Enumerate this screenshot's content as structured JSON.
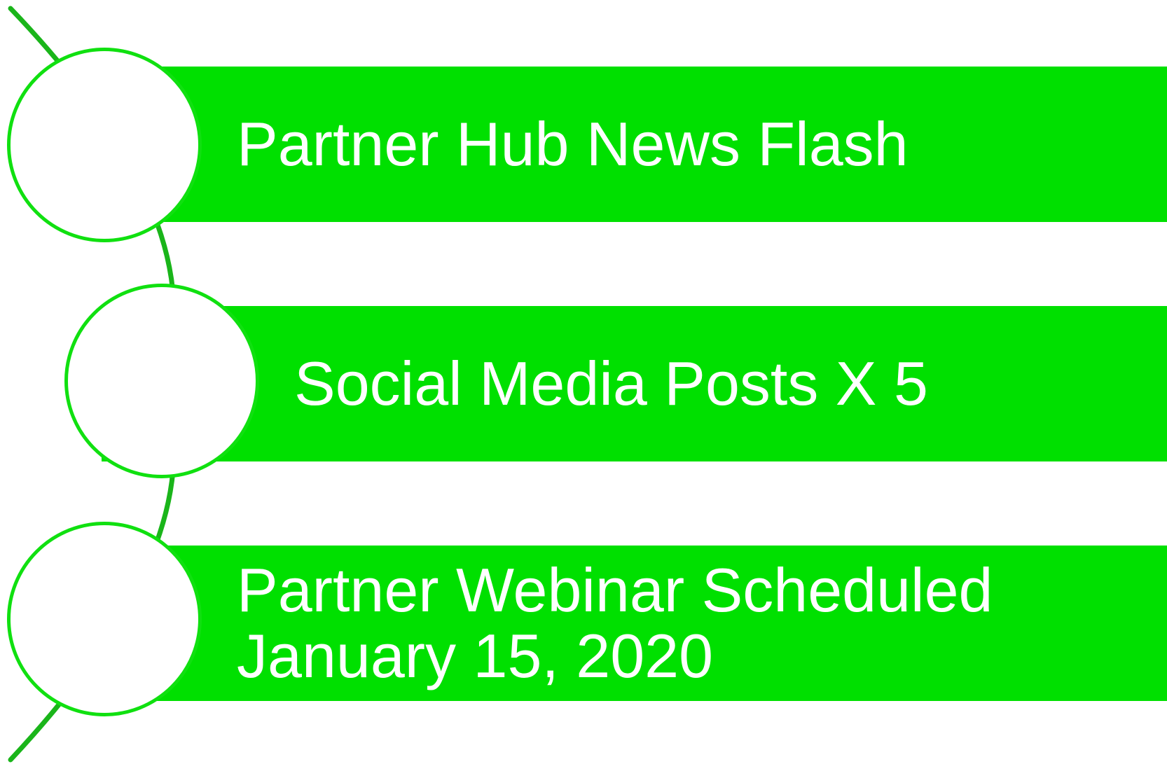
{
  "colors": {
    "band": "#00e000",
    "node_outline": "#10e010",
    "connector": "#1ab51a",
    "text": "#ffffff",
    "node_fill": "#ffffff"
  },
  "items": [
    {
      "lines": [
        "Partner Hub News Flash"
      ]
    },
    {
      "lines": [
        "Social Media Posts X 5"
      ]
    },
    {
      "lines": [
        "Partner Webinar Scheduled",
        "January 15, 2020"
      ]
    }
  ]
}
